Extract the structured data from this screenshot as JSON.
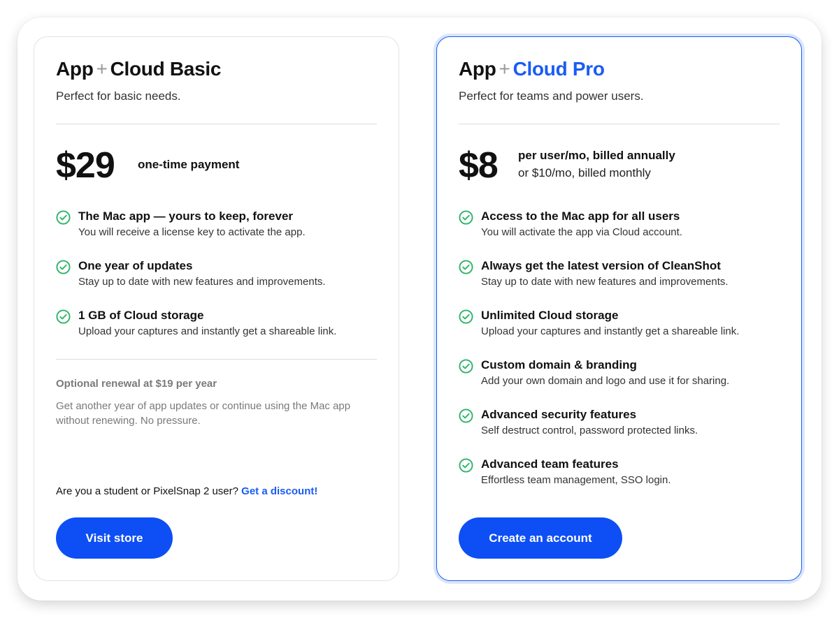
{
  "colors": {
    "accent": "#1a5cf4",
    "button": "#0d4ff5",
    "check": "#2fb36b"
  },
  "basic": {
    "title_prefix": "App",
    "title_plus": "+",
    "title_name": "Cloud Basic",
    "subtitle": "Perfect for basic needs.",
    "price": "$29",
    "price_note": "one-time payment",
    "features": [
      {
        "icon": "check-circle-icon",
        "title": "The Mac app — yours to keep, forever",
        "desc": "You will receive a license key to activate the app."
      },
      {
        "icon": "check-circle-icon",
        "title": "One year of updates",
        "desc": "Stay up to date with new features and improvements."
      },
      {
        "icon": "check-circle-icon",
        "title": "1 GB of Cloud storage",
        "desc": "Upload your captures and instantly get a shareable link."
      }
    ],
    "renewal_title": "Optional renewal at $19 per year",
    "renewal_desc": "Get another year of app updates or continue using the Mac app without renewing. No pressure.",
    "discount_text": "Are you a student or PixelSnap 2 user?",
    "discount_link": "Get a discount!",
    "button_label": "Visit store"
  },
  "pro": {
    "title_prefix": "App",
    "title_plus": "+",
    "title_name": "Cloud Pro",
    "subtitle": "Perfect for teams and power users.",
    "price": "$8",
    "price_note": "per user/mo, billed annually",
    "price_sub": "or $10/mo, billed monthly",
    "features": [
      {
        "icon": "check-circle-icon",
        "title": "Access to the Mac app for all users",
        "desc": "You will activate the app via Cloud account."
      },
      {
        "icon": "check-circle-icon",
        "title": "Always get the latest version of CleanShot",
        "desc": "Stay up to date with new features and improvements."
      },
      {
        "icon": "check-circle-icon",
        "title": "Unlimited Cloud storage",
        "desc": "Upload your captures and instantly get a shareable link."
      },
      {
        "icon": "check-circle-icon",
        "title": "Custom domain & branding",
        "desc": "Add your own domain and logo and use it for sharing."
      },
      {
        "icon": "check-circle-icon",
        "title": "Advanced security features",
        "desc": "Self destruct control, password protected links."
      },
      {
        "icon": "check-circle-icon",
        "title": "Advanced team features",
        "desc": "Effortless team management, SSO login."
      }
    ],
    "button_label": "Create an account"
  }
}
